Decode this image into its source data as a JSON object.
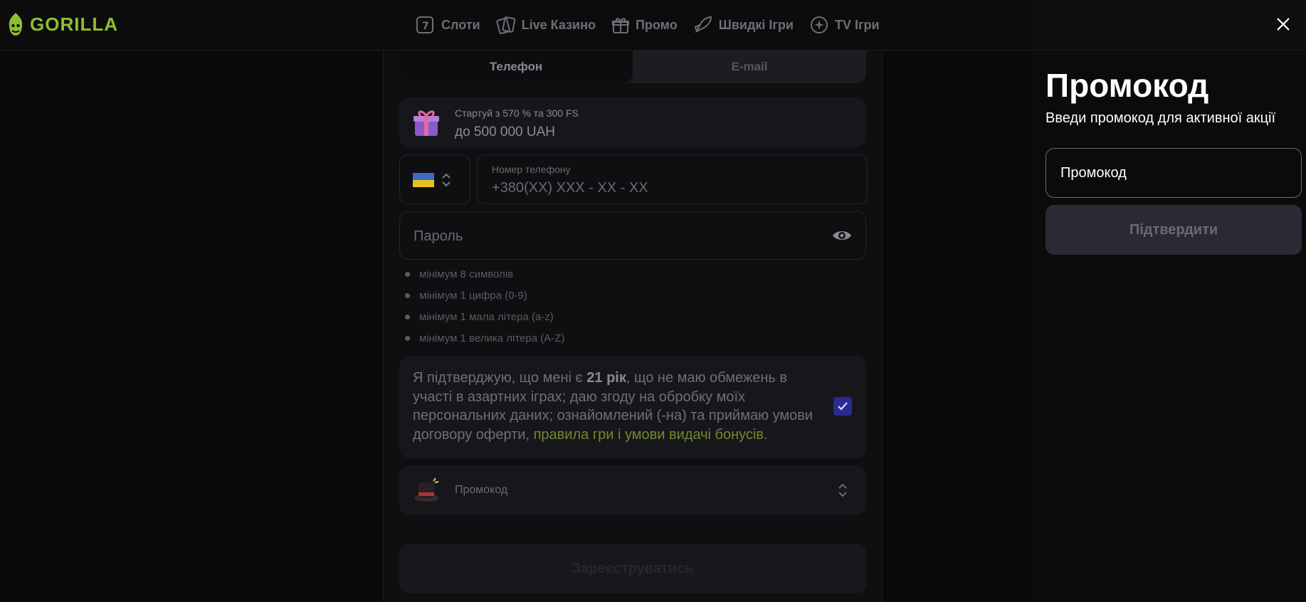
{
  "header": {
    "logo_text": "GORILLA",
    "nav": [
      {
        "label": "Слоти",
        "icon": "slot-icon"
      },
      {
        "label": "Live Казино",
        "icon": "cards-icon"
      },
      {
        "label": "Промо",
        "icon": "gift-icon"
      },
      {
        "label": "Швидкі Ігри",
        "icon": "rocket-icon"
      },
      {
        "label": "TV Ігри",
        "icon": "sparkle-icon"
      }
    ]
  },
  "form": {
    "tabs": {
      "phone": "Телефон",
      "email": "E-mail"
    },
    "bonus": {
      "line1": "Стартуй з 570 % та 300 FS",
      "line2": "до 500 000 UAH"
    },
    "phone": {
      "label": "Номер телефону",
      "prefix": "+380",
      "mask": "(XX) XXX - XX - XX"
    },
    "password_placeholder": "Пароль",
    "rules": [
      "мінімум 8 символів",
      "мінімум 1 цифра (0-9)",
      "мінімум 1 мала літера (a-z)",
      "мінімум 1 велика літера (A-Z)"
    ],
    "consent": {
      "part1": "Я підтверджую, що мені є ",
      "bold": "21 рік",
      "part2": ", що не маю обмежень в участі в азартних іграх; даю згоду на обробку моїх персональних даних; ознайомлений (-на) та приймаю умови договору оферти, ",
      "link1": "правила гри",
      "sep": " і ",
      "link2": "умови видачі бонусів",
      "end": ".",
      "checked": true
    },
    "promo_label": "Промокод",
    "register_label": "Зареєструватись"
  },
  "panel": {
    "title": "Промокод",
    "subtitle": "Введи промокод для активної акції",
    "input_placeholder": "Промокод",
    "confirm_label": "Підтвердити"
  },
  "colors": {
    "brand": "#8fbf2e",
    "link": "#708a2a",
    "checkbox": "#2a2a8f"
  }
}
